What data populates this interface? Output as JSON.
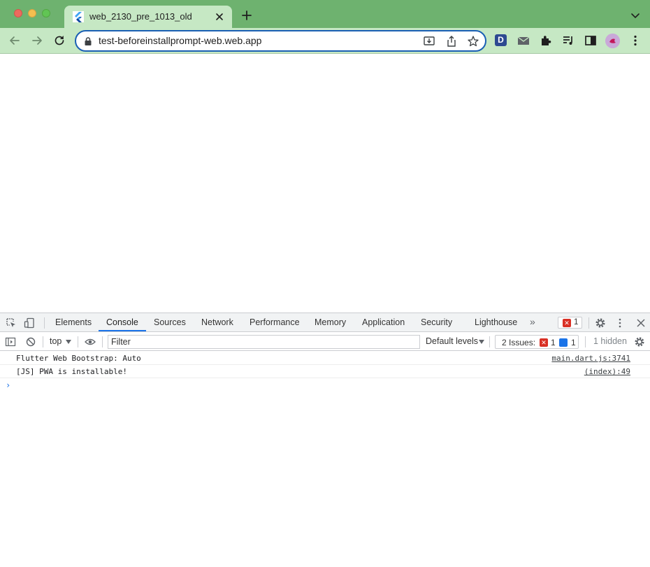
{
  "browser": {
    "tab": {
      "title": "web_2130_pre_1013_old"
    },
    "address": {
      "url": "test-beforeinstallprompt-web.web.app"
    },
    "colors": {
      "frame": "#6eb26f",
      "toolbar": "#c6e8c4",
      "focus_ring": "#1a5fb4"
    }
  },
  "devtools": {
    "tabs": [
      {
        "label": "Elements"
      },
      {
        "label": "Console"
      },
      {
        "label": "Sources"
      },
      {
        "label": "Network"
      },
      {
        "label": "Performance"
      },
      {
        "label": "Memory"
      },
      {
        "label": "Application"
      },
      {
        "label": "Security"
      },
      {
        "label": "Lighthouse"
      }
    ],
    "active_tab": "Console",
    "more_tabs_glyph": "»",
    "error_count": "1",
    "filterbar": {
      "context": "top",
      "filter_placeholder": "Filter",
      "levels": "Default levels",
      "issues_label": "2 Issues:",
      "issues_errors": "1",
      "issues_info": "1",
      "hidden": "1 hidden"
    },
    "messages": [
      {
        "text": "Flutter Web Bootstrap: Auto",
        "source": "main.dart.js:3741"
      },
      {
        "text": "[JS] PWA is installable!",
        "source": "(index):49"
      }
    ],
    "prompt_glyph": "›",
    "colors": {
      "error": "#d93025",
      "info": "#1a73e8",
      "active_underline": "#1a73e8"
    }
  }
}
